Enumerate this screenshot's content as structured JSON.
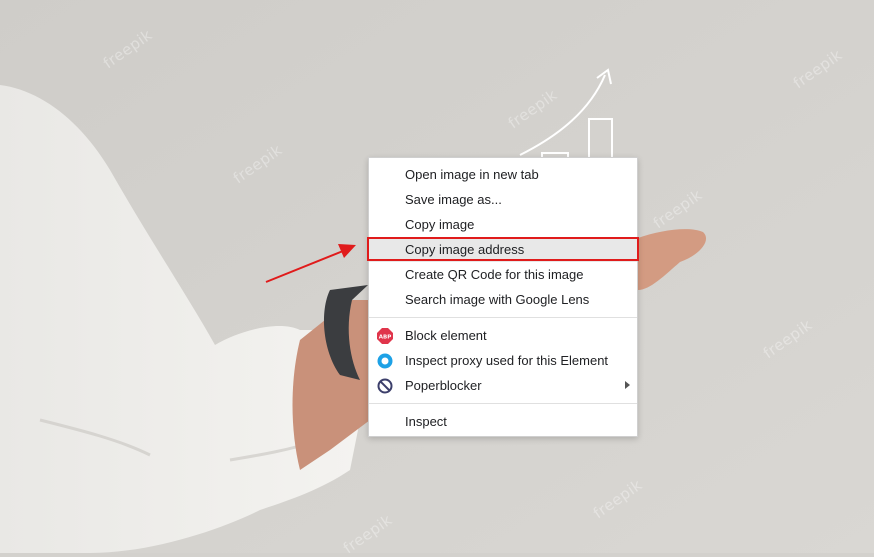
{
  "watermark": {
    "text": "freepik"
  },
  "context_menu": {
    "items": [
      {
        "label": "Open image in new tab"
      },
      {
        "label": "Save image as..."
      },
      {
        "label": "Copy image"
      },
      {
        "label": "Copy image address"
      },
      {
        "label": "Create QR Code for this image"
      },
      {
        "label": "Search image with Google Lens"
      },
      {
        "label": "Block element",
        "icon": "adblock-plus-icon",
        "icon_text": "ABP"
      },
      {
        "label": "Inspect proxy used for this Element",
        "icon": "proxy-icon"
      },
      {
        "label": "Poperblocker",
        "icon": "poperblocker-icon"
      },
      {
        "label": "Inspect"
      }
    ]
  },
  "colors": {
    "annotation_red": "#e01b1b",
    "abp_red": "#e0354b",
    "proxy_blue": "#1da1e6",
    "background": "#d3d1cd"
  }
}
